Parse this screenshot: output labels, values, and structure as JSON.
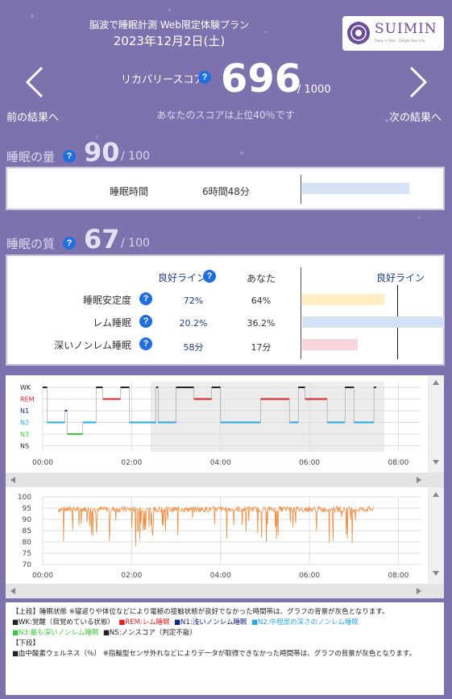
{
  "header": {
    "plan_title": "脳波で睡眠計測 Web限定体験プラン",
    "date": "2023年12月2日(土)",
    "logo_text": "SUIMIN",
    "logo_subtext": "Sleep is Vital · Delight Your Life"
  },
  "score": {
    "label": "リカバリースコア",
    "value": "696",
    "max": "/ 1000",
    "rank_text": "あなたのスコアは上位40％です",
    "prev_label": "前の結果へ",
    "next_label": "次の結果へ"
  },
  "quantity": {
    "title": "睡眠の量",
    "score": "90",
    "max": "/ 100",
    "row_label": "睡眠時間",
    "row_value": "6時間48分",
    "bar_fraction": 0.88
  },
  "quality": {
    "title": "睡眠の質",
    "score": "67",
    "max": "/ 100",
    "col_good": "良好ライン",
    "col_you": "あなた",
    "chart_good_label": "良好ライン",
    "rows": [
      {
        "label": "睡眠安定度",
        "good": "72%",
        "you": "64%",
        "color": "#fdeec4",
        "fraction": 0.58
      },
      {
        "label": "レム睡眠",
        "good": "20.2%",
        "you": "36.2%",
        "color": "#d4e3f3",
        "fraction": 1.0
      },
      {
        "label": "深いノンレム睡眠",
        "good": "58分",
        "you": "17分",
        "color": "#f6d6dc",
        "fraction": 0.39
      }
    ]
  },
  "hypnogram": {
    "stage_labels": [
      "WK",
      "REM",
      "N1",
      "N2",
      "N3",
      "NS"
    ],
    "stage_colors": [
      "#222222",
      "#e02020",
      "#1a237e",
      "#29a8e0",
      "#3ec63e",
      "#222222"
    ],
    "time_ticks": [
      "00:00",
      "02:00",
      "04:00",
      "06:00",
      "08:00"
    ]
  },
  "spo2": {
    "y_ticks": [
      "100",
      "95",
      "90",
      "85",
      "80",
      "75",
      "70"
    ],
    "time_ticks": [
      "00:00",
      "02:00",
      "04:00",
      "06:00",
      "08:00"
    ]
  },
  "legend": {
    "line1": "【上段】睡眠状態 ※寝返りや体位などにより電極の接触状態が良好でなかった時間帯は、グラフの背景が灰色となります。",
    "wk": "■WK:覚醒（目覚めている状態）",
    "rem": "■REM:レム睡眠",
    "n1": "■N1:浅いノンレム睡眠",
    "n2": "■N2:中程度の深さのノンレム睡眠",
    "n3": "■N3:最も深いノンレム睡眠",
    "ns": "■NS:ノンスコア（判定不能）",
    "lower_title": "【下段】",
    "spo2_line": "■血中酸素ウェルネス（％） ※指輪型センサ外れなどによりデータが取得できなかった時間帯は、グラフの背景が灰色となります。"
  }
}
